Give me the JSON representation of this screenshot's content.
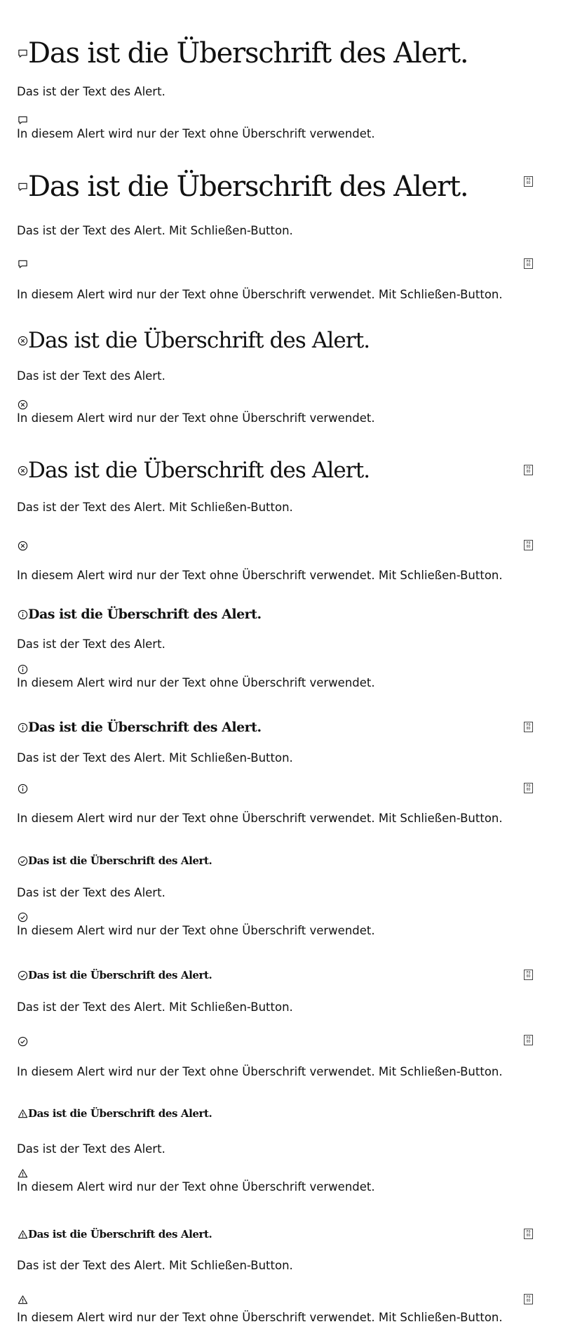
{
  "alerts": {
    "heading": "Das ist die Überschrift des Alert.",
    "text": "Das ist der Text des Alert.",
    "text_closable": "Das ist der Text des Alert. Mit Schließen-Button.",
    "text_only": "In diesem Alert wird nur der Text ohne Überschrift verwendet.",
    "text_only_closable": "In diesem Alert wird nur der Text ohne Überschrift verwendet. Mit Schließen-Button.",
    "close_button_glyph_top": "F0",
    "close_button_glyph_bottom": "0D"
  },
  "icons": {
    "default": "speech-bubble-icon",
    "error": "circle-x-icon",
    "info": "circle-info-icon",
    "success": "circle-check-icon",
    "warning": "warning-triangle-icon"
  },
  "colors": {
    "text": "#111111",
    "background": "#ffffff"
  }
}
